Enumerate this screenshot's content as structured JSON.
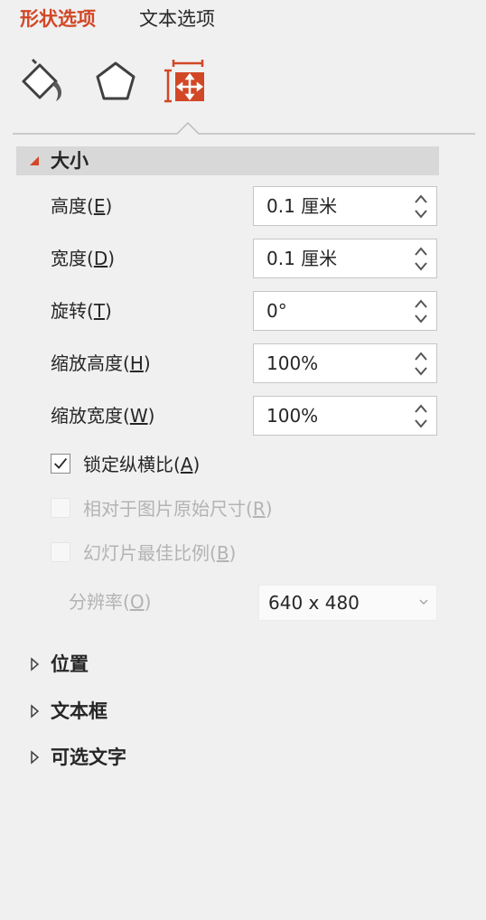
{
  "tabs": {
    "shape_options": "形状选项",
    "text_options": "文本选项"
  },
  "icons": {
    "fill_line": "paint-bucket-icon",
    "effects": "pentagon-icon",
    "size_properties": "size-properties-icon"
  },
  "colors": {
    "accent": "#d24726",
    "panel_bg": "#f0f0f0",
    "section_header_bg": "#d8d8d8"
  },
  "size_section": {
    "title": "大小",
    "fields": [
      {
        "label": "高度(",
        "key": "E",
        "close": ")",
        "value": "0.1 厘米"
      },
      {
        "label": "宽度(",
        "key": "D",
        "close": ")",
        "value": "0.1 厘米"
      },
      {
        "label": "旋转(",
        "key": "T",
        "close": ")",
        "value": "0°"
      },
      {
        "label": "缩放高度(",
        "key": "H",
        "close": ")",
        "value": "100%"
      },
      {
        "label": "缩放宽度(",
        "key": "W",
        "close": ")",
        "value": "100%"
      }
    ],
    "lock_aspect": {
      "label": "锁定纵横比(",
      "key": "A",
      "close": ")",
      "checked": true,
      "enabled": true
    },
    "relative_original": {
      "label": "相对于图片原始尺寸(",
      "key": "R",
      "close": ")",
      "checked": false,
      "enabled": false
    },
    "best_slide_scale": {
      "label": "幻灯片最佳比例(",
      "key": "B",
      "close": ")",
      "checked": false,
      "enabled": false
    },
    "resolution": {
      "label": "分辨率(",
      "key": "O",
      "close": ")",
      "value": "640 x 480",
      "enabled": false
    }
  },
  "collapsed_sections": {
    "position": "位置",
    "text_box": "文本框",
    "alt_text": "可选文字"
  }
}
